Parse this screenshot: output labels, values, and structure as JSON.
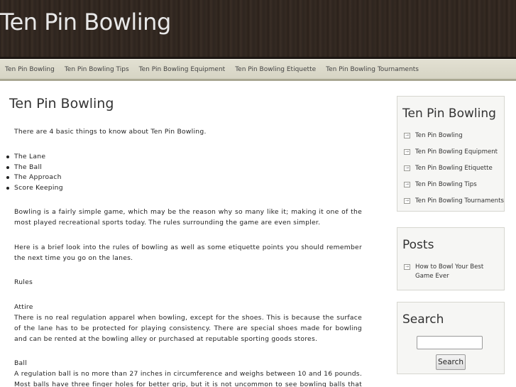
{
  "site": {
    "title": "Ten Pin Bowling"
  },
  "nav": {
    "items": [
      "Ten Pin Bowling",
      "Ten Pin Bowling Tips",
      "Ten Pin Bowling Equipment",
      "Ten Pin Bowling Etiquette",
      "Ten Pin Bowling Tournaments"
    ]
  },
  "main": {
    "heading": "Ten Pin Bowling",
    "intro": "There are 4 basic things to know about Ten Pin Bowling.",
    "bullets": [
      "The Lane",
      "The Ball",
      "The Approach",
      "Score Keeping"
    ],
    "p1": "Bowling is a fairly simple game, which may be the reason why so many like it; making it one of the most played recreational sports today. The rules surrounding the game are even simpler.",
    "p2": "Here is a brief look into the rules of bowling as well as some etiquette points you should remember the next time you go on the lanes.",
    "rules_label": "Rules",
    "attire_label": "Attire",
    "attire_text": "There is no real regulation apparel when bowling, except for the shoes. This is because the surface of the lane has to be protected for playing consistency. There are special shoes made for bowling and can be rented at the bowling alley or purchased at reputable sporting goods stores.",
    "ball_label": "Ball",
    "ball_text": "A regulation ball is no more than 27 inches in circumference and weighs between 10 and 16 pounds. Most balls have three finger holes for better grip, but it is not uncommon to see bowling balls that have just"
  },
  "sidebar": {
    "pages_widget": {
      "title": "Ten Pin Bowling",
      "items": [
        "Ten Pin Bowling",
        "Ten Pin Bowling Equipment",
        "Ten Pin Bowling Etiquette",
        "Ten Pin Bowling Tips",
        "Ten Pin Bowling Tournaments"
      ]
    },
    "posts_widget": {
      "title": "Posts",
      "items": [
        "How to Bowl Your Best Game Ever"
      ]
    },
    "search_widget": {
      "title": "Search",
      "input_value": "",
      "button_label": "Search"
    }
  },
  "icons": {
    "list_bullet": "arrow-box-icon"
  },
  "colors": {
    "header_bg": "#2e251f",
    "nav_bg": "#dcdaca",
    "widget_bg": "#f6f6f4"
  }
}
